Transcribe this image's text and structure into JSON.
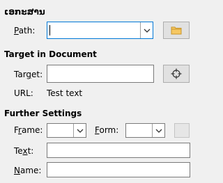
{
  "header": {
    "title": "ເອກະສານ"
  },
  "document": {
    "path_label_mnemonic": "P",
    "path_label_rest": "ath:",
    "path_value": "",
    "open_file_icon": "folder-icon"
  },
  "target_section": {
    "title": "Target in Document",
    "target_label_pre": "Tar",
    "target_label_mnemonic": "g",
    "target_label_rest": "et:",
    "target_value": "",
    "target_icon": "crosshair-icon",
    "url_label": "URL:",
    "url_value": "Test text"
  },
  "further_settings": {
    "title": "Further Settings",
    "frame_label_pre": "F",
    "frame_label_mnemonic": "r",
    "frame_label_rest": "ame:",
    "frame_value": "",
    "form_label_mnemonic": "F",
    "form_label_rest": "orm:",
    "form_value": "",
    "text_label_pre": "Te",
    "text_label_mnemonic": "x",
    "text_label_rest": "t:",
    "text_value": "",
    "name_label_mnemonic": "N",
    "name_label_rest": "ame:",
    "name_value": ""
  }
}
